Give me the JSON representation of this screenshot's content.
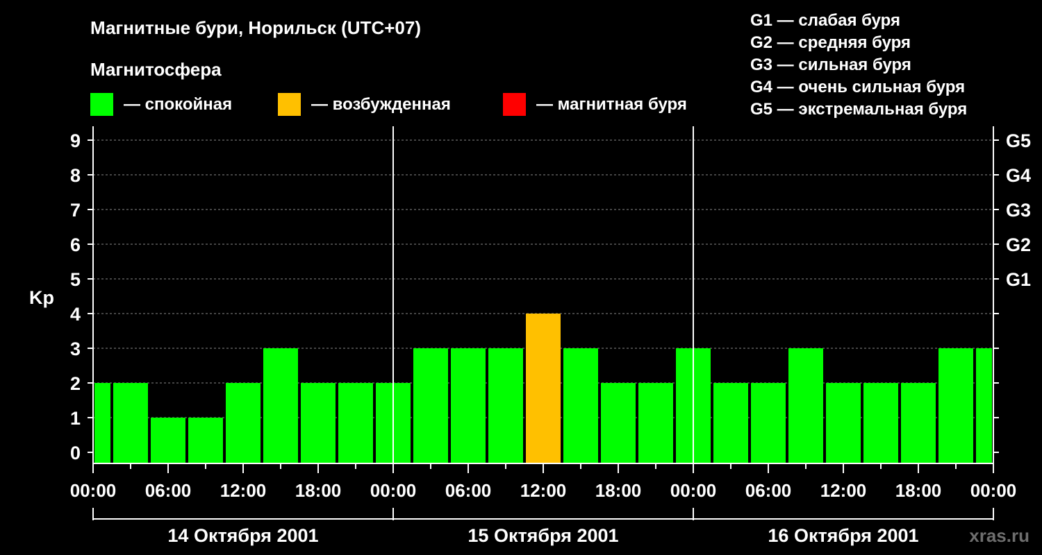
{
  "title": "Магнитные бури, Норильск (UTC+07)",
  "magnetosphere_heading": "Магнитосфера",
  "legend": [
    {
      "color": "#00ff00",
      "label": "— спокойная"
    },
    {
      "color": "#ffc000",
      "label": "— возбужденная"
    },
    {
      "color": "#ff0000",
      "label": "— магнитная буря"
    }
  ],
  "storm_scale": [
    "G1 — слабая буря",
    "G2 — средняя буря",
    "G3 — сильная буря",
    "G4 — очень сильная буря",
    "G5 — экстремальная буря"
  ],
  "watermark": "xras.ru",
  "chart_data": {
    "type": "bar",
    "ylabel": "Kp",
    "ylim": [
      0,
      9
    ],
    "yticks": [
      0,
      1,
      2,
      3,
      4,
      5,
      6,
      7,
      8,
      9
    ],
    "right_axis_labels": [
      {
        "kp": 5,
        "label": "G1"
      },
      {
        "kp": 6,
        "label": "G2"
      },
      {
        "kp": 7,
        "label": "G3"
      },
      {
        "kp": 8,
        "label": "G4"
      },
      {
        "kp": 9,
        "label": "G5"
      }
    ],
    "x_tick_labels": [
      "00:00",
      "06:00",
      "12:00",
      "18:00",
      "00:00",
      "06:00",
      "12:00",
      "18:00",
      "00:00",
      "06:00",
      "12:00",
      "18:00",
      "00:00"
    ],
    "days": [
      "14 Октября 2001",
      "15 Октября 2001",
      "16 Октября 2001"
    ],
    "interval_hours": 3,
    "values": [
      2,
      2,
      1,
      1,
      2,
      3,
      2,
      2,
      2,
      3,
      3,
      3,
      4,
      3,
      2,
      2,
      3,
      2,
      2,
      3,
      2,
      2,
      2,
      3,
      3
    ],
    "colors": {
      "quiet": "#00ff00",
      "active": "#ffc000",
      "storm": "#ff0000"
    },
    "gridlines": true
  }
}
